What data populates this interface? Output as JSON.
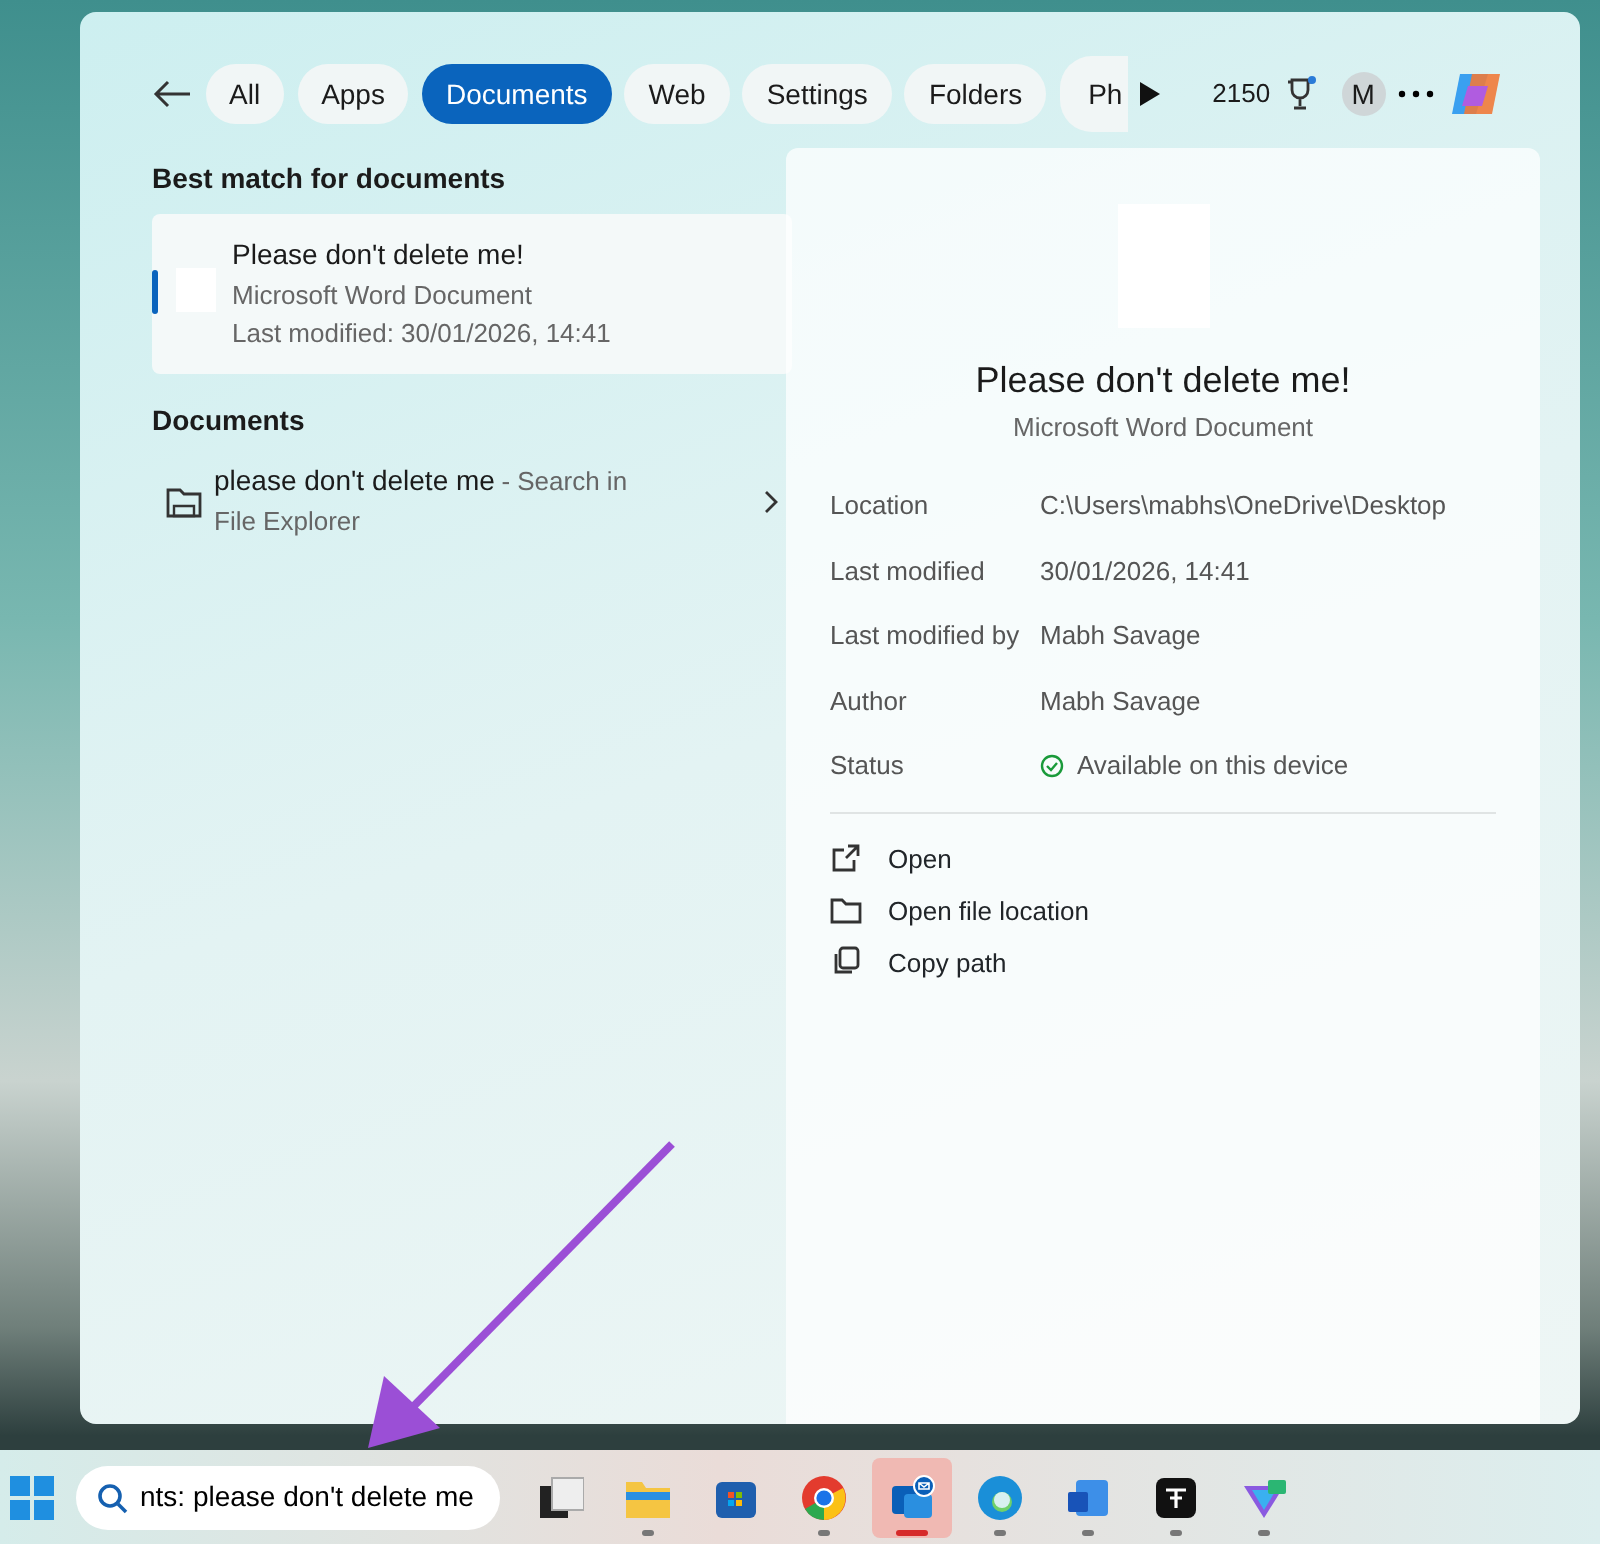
{
  "filters": [
    {
      "label": "All",
      "selected": false
    },
    {
      "label": "Apps",
      "selected": false
    },
    {
      "label": "Documents",
      "selected": true
    },
    {
      "label": "Web",
      "selected": false
    },
    {
      "label": "Settings",
      "selected": false
    },
    {
      "label": "Folders",
      "selected": false
    },
    {
      "label": "Ph",
      "selected": false
    }
  ],
  "points": "2150",
  "avatar": "M",
  "best_match": {
    "heading": "Best match for documents",
    "title": "Please don't delete me!",
    "type": "Microsoft Word Document",
    "modified": "Last modified: 30/01/2026, 14:41",
    "selected": true
  },
  "documents": {
    "heading": "Documents",
    "items": [
      {
        "name": "please don't delete me",
        "hint": "- Search in",
        "location": "File Explorer"
      }
    ]
  },
  "detail": {
    "title": "Please don't delete me!",
    "type": "Microsoft Word Document",
    "properties": [
      {
        "label": "Location",
        "value": "C:\\Users\\mabhs\\OneDrive\\Desktop",
        "kind": "text"
      },
      {
        "label": "Last modified",
        "value": "30/01/2026, 14:41",
        "kind": "text"
      },
      {
        "label": "Last modified by",
        "value": "Mabh Savage",
        "kind": "text"
      },
      {
        "label": "Author",
        "value": "Mabh Savage",
        "kind": "text"
      },
      {
        "label": "Status",
        "value": "Available on this device",
        "kind": "status"
      }
    ],
    "actions": [
      {
        "label": "Open",
        "kind": "open"
      },
      {
        "label": "Open file location",
        "kind": "folder"
      },
      {
        "label": "Copy path",
        "kind": "copy"
      }
    ]
  },
  "search": {
    "value": "nts: please don't delete me"
  },
  "taskbar": [
    {
      "kind": "taskview",
      "running": false,
      "selected": false
    },
    {
      "kind": "folder",
      "running": true,
      "selected": false
    },
    {
      "kind": "store",
      "running": false,
      "selected": false
    },
    {
      "kind": "chrome",
      "running": true,
      "selected": false
    },
    {
      "kind": "mail",
      "running": true,
      "selected": true
    },
    {
      "kind": "edge",
      "running": true,
      "selected": false
    },
    {
      "kind": "word",
      "running": true,
      "selected": false
    },
    {
      "kind": "terminal",
      "running": true,
      "selected": false
    },
    {
      "kind": "vpn",
      "running": true,
      "selected": false
    }
  ]
}
